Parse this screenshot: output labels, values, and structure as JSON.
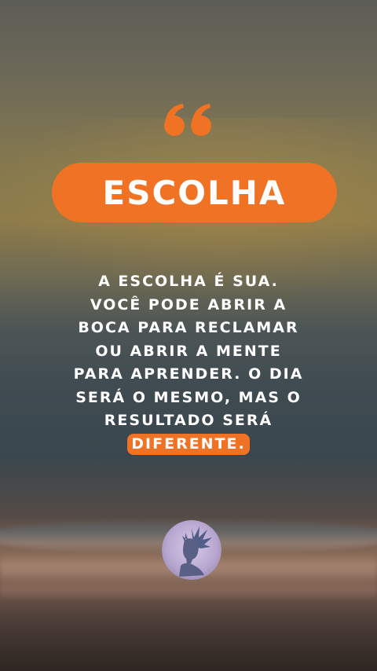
{
  "title": "ESCOLHA",
  "quote_lines": [
    "A ESCOLHA É SUA.",
    "VOCÊ PODE ABRIR A",
    "BOCA PARA RECLAMAR",
    "OU ABRIR A MENTE",
    "PARA APRENDER. O DIA",
    "SERÁ O MESMO, MAS O",
    "RESULTADO SERÁ"
  ],
  "highlight_word": "DIFERENTE.",
  "colors": {
    "accent": "#f07224",
    "text": "#ffffff"
  },
  "icons": {
    "quote": "quote-mark-icon",
    "avatar": "author-avatar"
  }
}
